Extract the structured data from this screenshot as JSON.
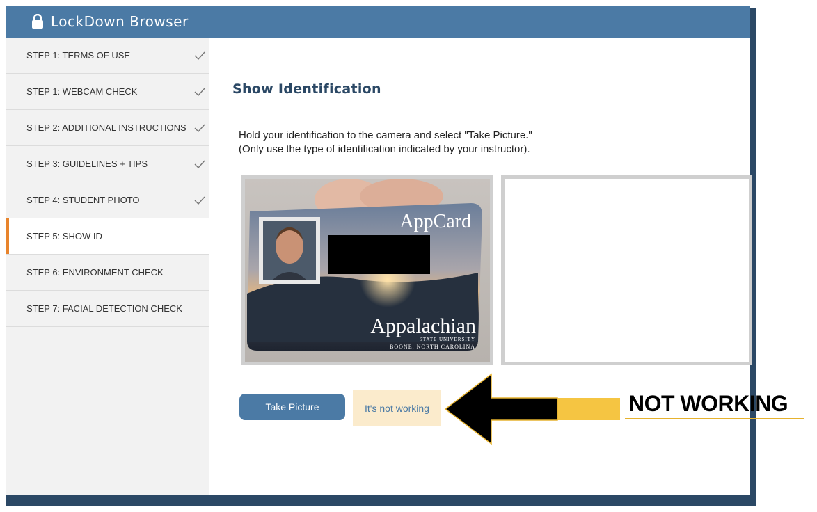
{
  "window": {
    "title": "LockDown Browser",
    "title_icon": "lock-icon"
  },
  "sidebar": {
    "steps": [
      {
        "label": "STEP 1: TERMS OF USE",
        "done": true
      },
      {
        "label": "STEP 1: WEBCAM CHECK",
        "done": true
      },
      {
        "label": "STEP 2: ADDITIONAL INSTRUCTIONS",
        "done": true
      },
      {
        "label": "STEP 3: GUIDELINES + TIPS",
        "done": true
      },
      {
        "label": "STEP 4: STUDENT PHOTO",
        "done": true
      },
      {
        "label": "STEP 5: SHOW ID",
        "done": false,
        "active": true
      },
      {
        "label": "STEP 6: ENVIRONMENT CHECK",
        "done": false
      },
      {
        "label": "STEP 7: FACIAL DETECTION CHECK",
        "done": false
      }
    ]
  },
  "main": {
    "heading": "Show Identification",
    "instruction_line1": "Hold your identification to the camera and select \"Take Picture.\"",
    "instruction_line2": "(Only use the type of identification indicated by your instructor).",
    "id_card": {
      "brand": "AppCard",
      "university": "Appalachian",
      "university_sub": "STATE UNIVERSITY",
      "location": "BOONE, NORTH CAROLINA"
    },
    "take_picture_label": "Take Picture",
    "not_working_link": "It's not working"
  },
  "annotation": {
    "label": "NOT WORKING",
    "arrow_color": "#000000",
    "accent_color": "#f5c542"
  },
  "colors": {
    "titlebar": "#4b7aa5",
    "frame": "#2b4865",
    "active_step": "#e8842c",
    "button": "#4b7aa5"
  }
}
